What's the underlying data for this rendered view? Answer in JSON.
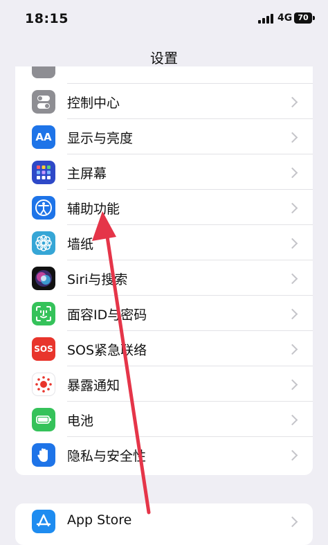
{
  "status_bar": {
    "time": "18:15",
    "network": "4G",
    "battery": "70"
  },
  "nav": {
    "title": "设置"
  },
  "settings": [
    {
      "label": "控制中心",
      "icon": "control-center-icon",
      "color": "#8e8e93"
    },
    {
      "label": "显示与亮度",
      "icon": "display-brightness-icon",
      "color": "#1e74e8"
    },
    {
      "label": "主屏幕",
      "icon": "home-screen-icon",
      "color": "#2e49c8"
    },
    {
      "label": "辅助功能",
      "icon": "accessibility-icon",
      "color": "#1e74e8"
    },
    {
      "label": "墙纸",
      "icon": "wallpaper-icon",
      "color": "#36a6d6"
    },
    {
      "label": "Siri与搜索",
      "icon": "siri-icon",
      "color": "#222222"
    },
    {
      "label": "面容ID与密码",
      "icon": "face-id-icon",
      "color": "#35c25a"
    },
    {
      "label": "SOS紧急联络",
      "icon": "sos-icon",
      "color": "#e8352c"
    },
    {
      "label": "暴露通知",
      "icon": "exposure-notification-icon",
      "color": "#ffffff"
    },
    {
      "label": "电池",
      "icon": "battery-icon",
      "color": "#35c25a"
    },
    {
      "label": "隐私与安全性",
      "icon": "privacy-hand-icon",
      "color": "#1e74e8"
    }
  ],
  "store_group": {
    "label": "App Store",
    "icon": "app-store-icon",
    "color": "#1e8cf0"
  },
  "sos_text": "SOS",
  "aa_text": "AA",
  "annotation": {
    "color": "#e53549"
  }
}
